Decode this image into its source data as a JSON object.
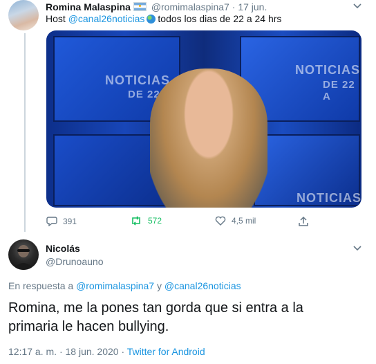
{
  "parent_tweet": {
    "author_name": "Romina Malaspina",
    "handle": "@romimalaspina7",
    "separator": "·",
    "date": "17 jun.",
    "text_prefix": "Host",
    "mention": "@canal26noticias",
    "text_suffix": "todos los dias de 22 a 24 hrs",
    "media_text_1": "NOTICIAS",
    "media_text_2": "DE 22",
    "media_text_3": "NOTICIAS",
    "media_text_4": "DE 22 A",
    "media_text_5": "NOTICIAS",
    "actions": {
      "replies": "391",
      "retweets": "572",
      "likes": "4,5 mil"
    }
  },
  "reply_tweet": {
    "author_name": "Nicolás",
    "handle": "@Drunoauno",
    "reply_label": "En respuesta a",
    "reply_mention_1": "@romimalaspina7",
    "reply_conj": "y",
    "reply_mention_2": "@canal26noticias",
    "text": "Romina, me la pones tan gorda que si entra a la primaria le hacen bullying.",
    "time": "12:17 a. m.",
    "date": "18 jun. 2020",
    "sep": "·",
    "source": "Twitter for Android"
  },
  "colors": {
    "link": "#1b95e0",
    "muted": "#657786",
    "retweet": "#17bf63",
    "thread_line": "#ccd6dd"
  }
}
